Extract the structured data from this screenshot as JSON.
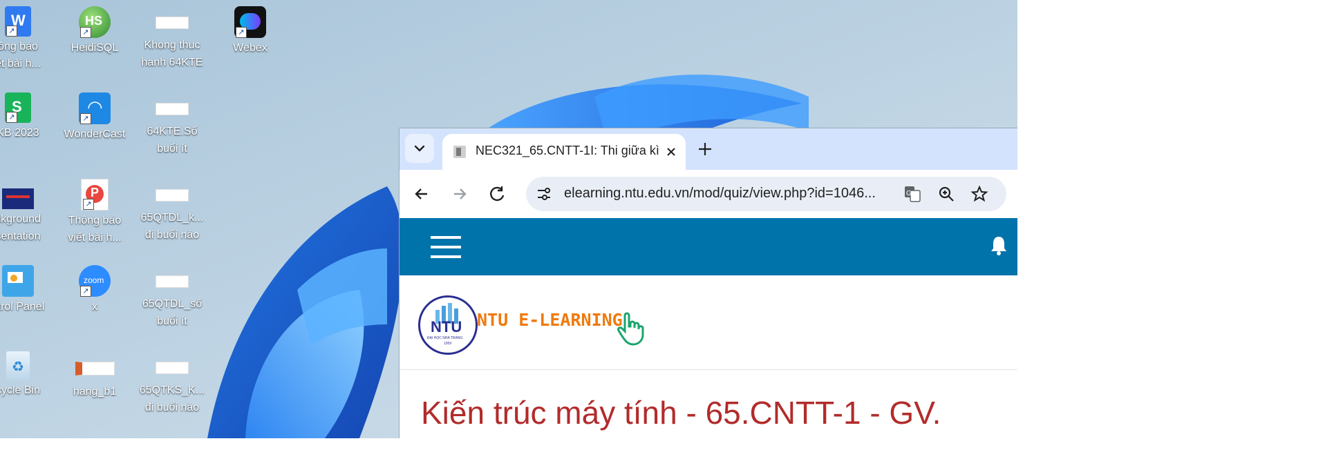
{
  "desktop": {
    "icons": [
      {
        "label1": "ông báo",
        "label2": "ết bài h...",
        "icon": "wps-writer-icon"
      },
      {
        "label1": "HeidiSQL",
        "label2": "",
        "icon": "heidisql-icon"
      },
      {
        "label1": "Khong thuc",
        "label2": "hanh 64KTE",
        "icon": "document-thumbnail-icon"
      },
      {
        "label1": "Webex",
        "label2": "",
        "icon": "webex-icon"
      },
      {
        "label1": "KB 2023",
        "label2": "",
        "icon": "wps-spreadsheet-icon"
      },
      {
        "label1": "WonderCast",
        "label2": "",
        "icon": "wondercast-icon"
      },
      {
        "label1": "64KTE.Số",
        "label2": "buổi ít",
        "icon": "document-thumbnail-icon"
      },
      {
        "label1": "ckground",
        "label2": "sentation",
        "icon": "presentation-thumbnail-icon"
      },
      {
        "label1": "Thông báo",
        "label2": "viết bài h...",
        "icon": "wps-presentation-icon"
      },
      {
        "label1": "65QTDL_k...",
        "label2": "đi buổi nào",
        "icon": "document-thumbnail-icon"
      },
      {
        "label1": "ntrol Panel",
        "label2": "",
        "icon": "control-panel-icon"
      },
      {
        "label1": "x",
        "label2": "",
        "icon": "zoom-icon"
      },
      {
        "label1": "65QTDL_số",
        "label2": "buổi ít",
        "icon": "document-thumbnail-icon"
      },
      {
        "label1": "cycle Bin",
        "label2": "",
        "icon": "recycle-bin-icon"
      },
      {
        "label1": "hang_b1",
        "label2": "",
        "icon": "image-thumbnail-icon"
      },
      {
        "label1": "65QTKS_K...",
        "label2": "đi buổi nào",
        "icon": "document-thumbnail-icon"
      }
    ]
  },
  "browser": {
    "tab": {
      "title": "NEC321_65.CNTT-1I: Thi giữa kì"
    },
    "address": {
      "url": "elearning.ntu.edu.vn/mod/quiz/view.php?id=1046..."
    },
    "site": {
      "brand": "NTU E-LEARNING",
      "logo_text": "NTU",
      "logo_sub": "ĐẠI HỌC NHA TRANG",
      "logo_year": "1959",
      "course_title": "Kiến trúc máy tính - 65.CNTT-1 - GV. "
    },
    "colors": {
      "tabbar": "#d3e3fd",
      "sitebar": "#0073aa",
      "brand": "#f07a0e",
      "title": "#b22b2b"
    }
  }
}
